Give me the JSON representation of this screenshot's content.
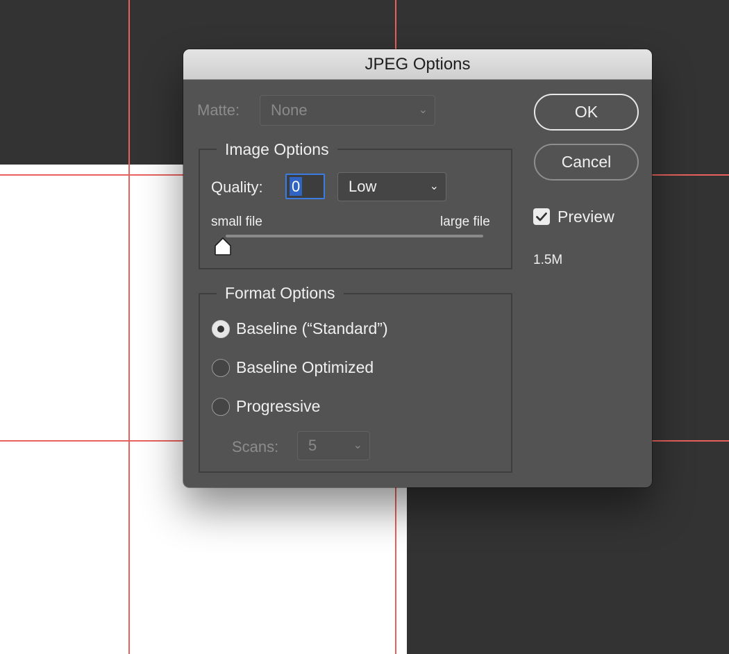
{
  "dialog": {
    "title": "JPEG Options",
    "matte": {
      "label": "Matte:",
      "value": "None"
    },
    "image_options": {
      "title": "Image Options",
      "quality_label": "Quality:",
      "quality_value": "0",
      "quality_preset": "Low",
      "small_file_label": "small file",
      "large_file_label": "large file",
      "slider_value": 0
    },
    "format_options": {
      "title": "Format Options",
      "options": [
        {
          "label": "Baseline (“Standard”)",
          "selected": true
        },
        {
          "label": "Baseline Optimized",
          "selected": false
        },
        {
          "label": "Progressive",
          "selected": false
        }
      ],
      "scans_label": "Scans:",
      "scans_value": "5"
    },
    "buttons": {
      "ok": "OK",
      "cancel": "Cancel"
    },
    "preview": {
      "label": "Preview",
      "checked": true
    },
    "file_size": "1.5M"
  },
  "icons": {
    "chevron": "chevron-down-icon",
    "check": "checkmark-icon",
    "slider": "slider-thumb-icon"
  },
  "colors": {
    "guide": "#e8615c",
    "dialog_bg": "#535353",
    "focus": "#3b7ce2",
    "selection": "#2f64c2"
  }
}
